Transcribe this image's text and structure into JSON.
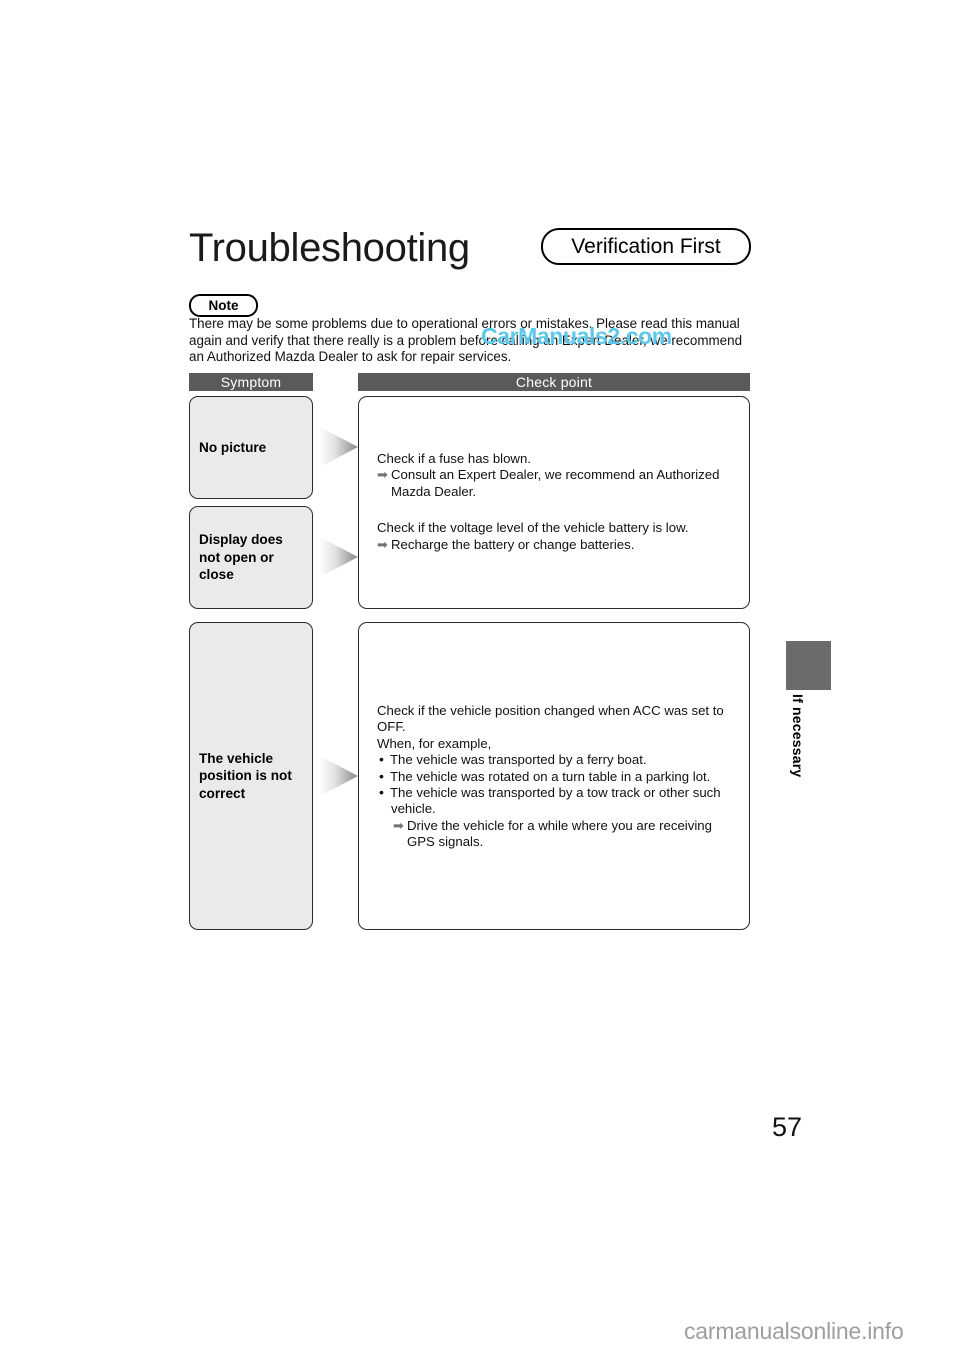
{
  "document": {
    "title": "Troubleshooting",
    "badge_verification": "Verification First",
    "note_label": "Note",
    "page_number": "57",
    "side_tab_label": "If necessary"
  },
  "intro": {
    "line1": "There may be some problems due to operational errors or mistakes. Please read this manual",
    "line2": "again and verify that there really is a problem before calling an Expert Dealer, we recommend",
    "line3": "an Authorized Mazda Dealer to ask for repair services."
  },
  "table": {
    "header_symptom": "Symptom",
    "header_checkpoint": "Check point",
    "rows": [
      {
        "symptom": "No picture",
        "checkpoint_lines": [
          "Check if a fuse has blown.",
          "Consult an Expert Dealer, we recommend an Authorized",
          "Mazda Dealer."
        ]
      },
      {
        "symptom_line1": "Display does",
        "symptom_line2": "not open or",
        "symptom_line3": "close",
        "checkpoint_lines": [
          "Check if the voltage level of the vehicle battery is low.",
          "Recharge the battery or change batteries."
        ]
      },
      {
        "symptom_line1": "The vehicle",
        "symptom_line2": "position is not",
        "symptom_line3": "correct",
        "checkpoint_lines": [
          "Check if the vehicle position changed when ACC was set to",
          "OFF.",
          "When, for example,",
          "The vehicle was transported by a ferry boat.",
          "The vehicle was rotated on a turn table in a parking lot.",
          "The vehicle was transported by a tow track or other such",
          "vehicle.",
          "Drive the vehicle for a while where you are receiving",
          "GPS signals."
        ]
      }
    ]
  },
  "glyphs": {
    "arrow": "➡",
    "bullet": "•"
  },
  "watermarks": {
    "center": "CarManuals2.com",
    "footer": "carmanualsonline.info"
  },
  "colors": {
    "header_bar": "#5a5a5a",
    "symptom_fill": "#eaeaea",
    "watermark_center": "#5bc8ec",
    "watermark_footer": "#9e9e9e",
    "side_tab": "#6b6b6b"
  }
}
